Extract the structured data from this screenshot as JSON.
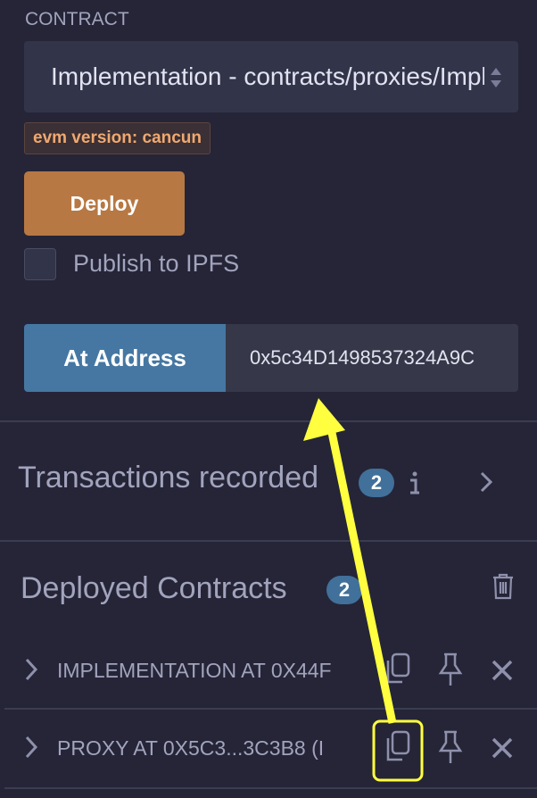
{
  "contract": {
    "label": "CONTRACT",
    "selected": "Implementation - contracts/proxies/Implementation.sol",
    "evm_badge": "evm version: cancun"
  },
  "deploy": {
    "label": "Deploy"
  },
  "publish": {
    "label": "Publish to IPFS",
    "checked": false
  },
  "at_address": {
    "label": "At Address",
    "value": "0x5c34D1498537324A9C"
  },
  "transactions": {
    "label": "Transactions recorded",
    "count": "2"
  },
  "deployed": {
    "label": "Deployed Contracts",
    "count": "2",
    "items": [
      {
        "label": "IMPLEMENTATION AT 0X44F"
      },
      {
        "label": "PROXY AT 0X5C3...3C3B8 (I"
      }
    ]
  },
  "colors": {
    "deploy": "#b77843",
    "at_address": "#4577a2",
    "annotation": "#ffff40"
  }
}
